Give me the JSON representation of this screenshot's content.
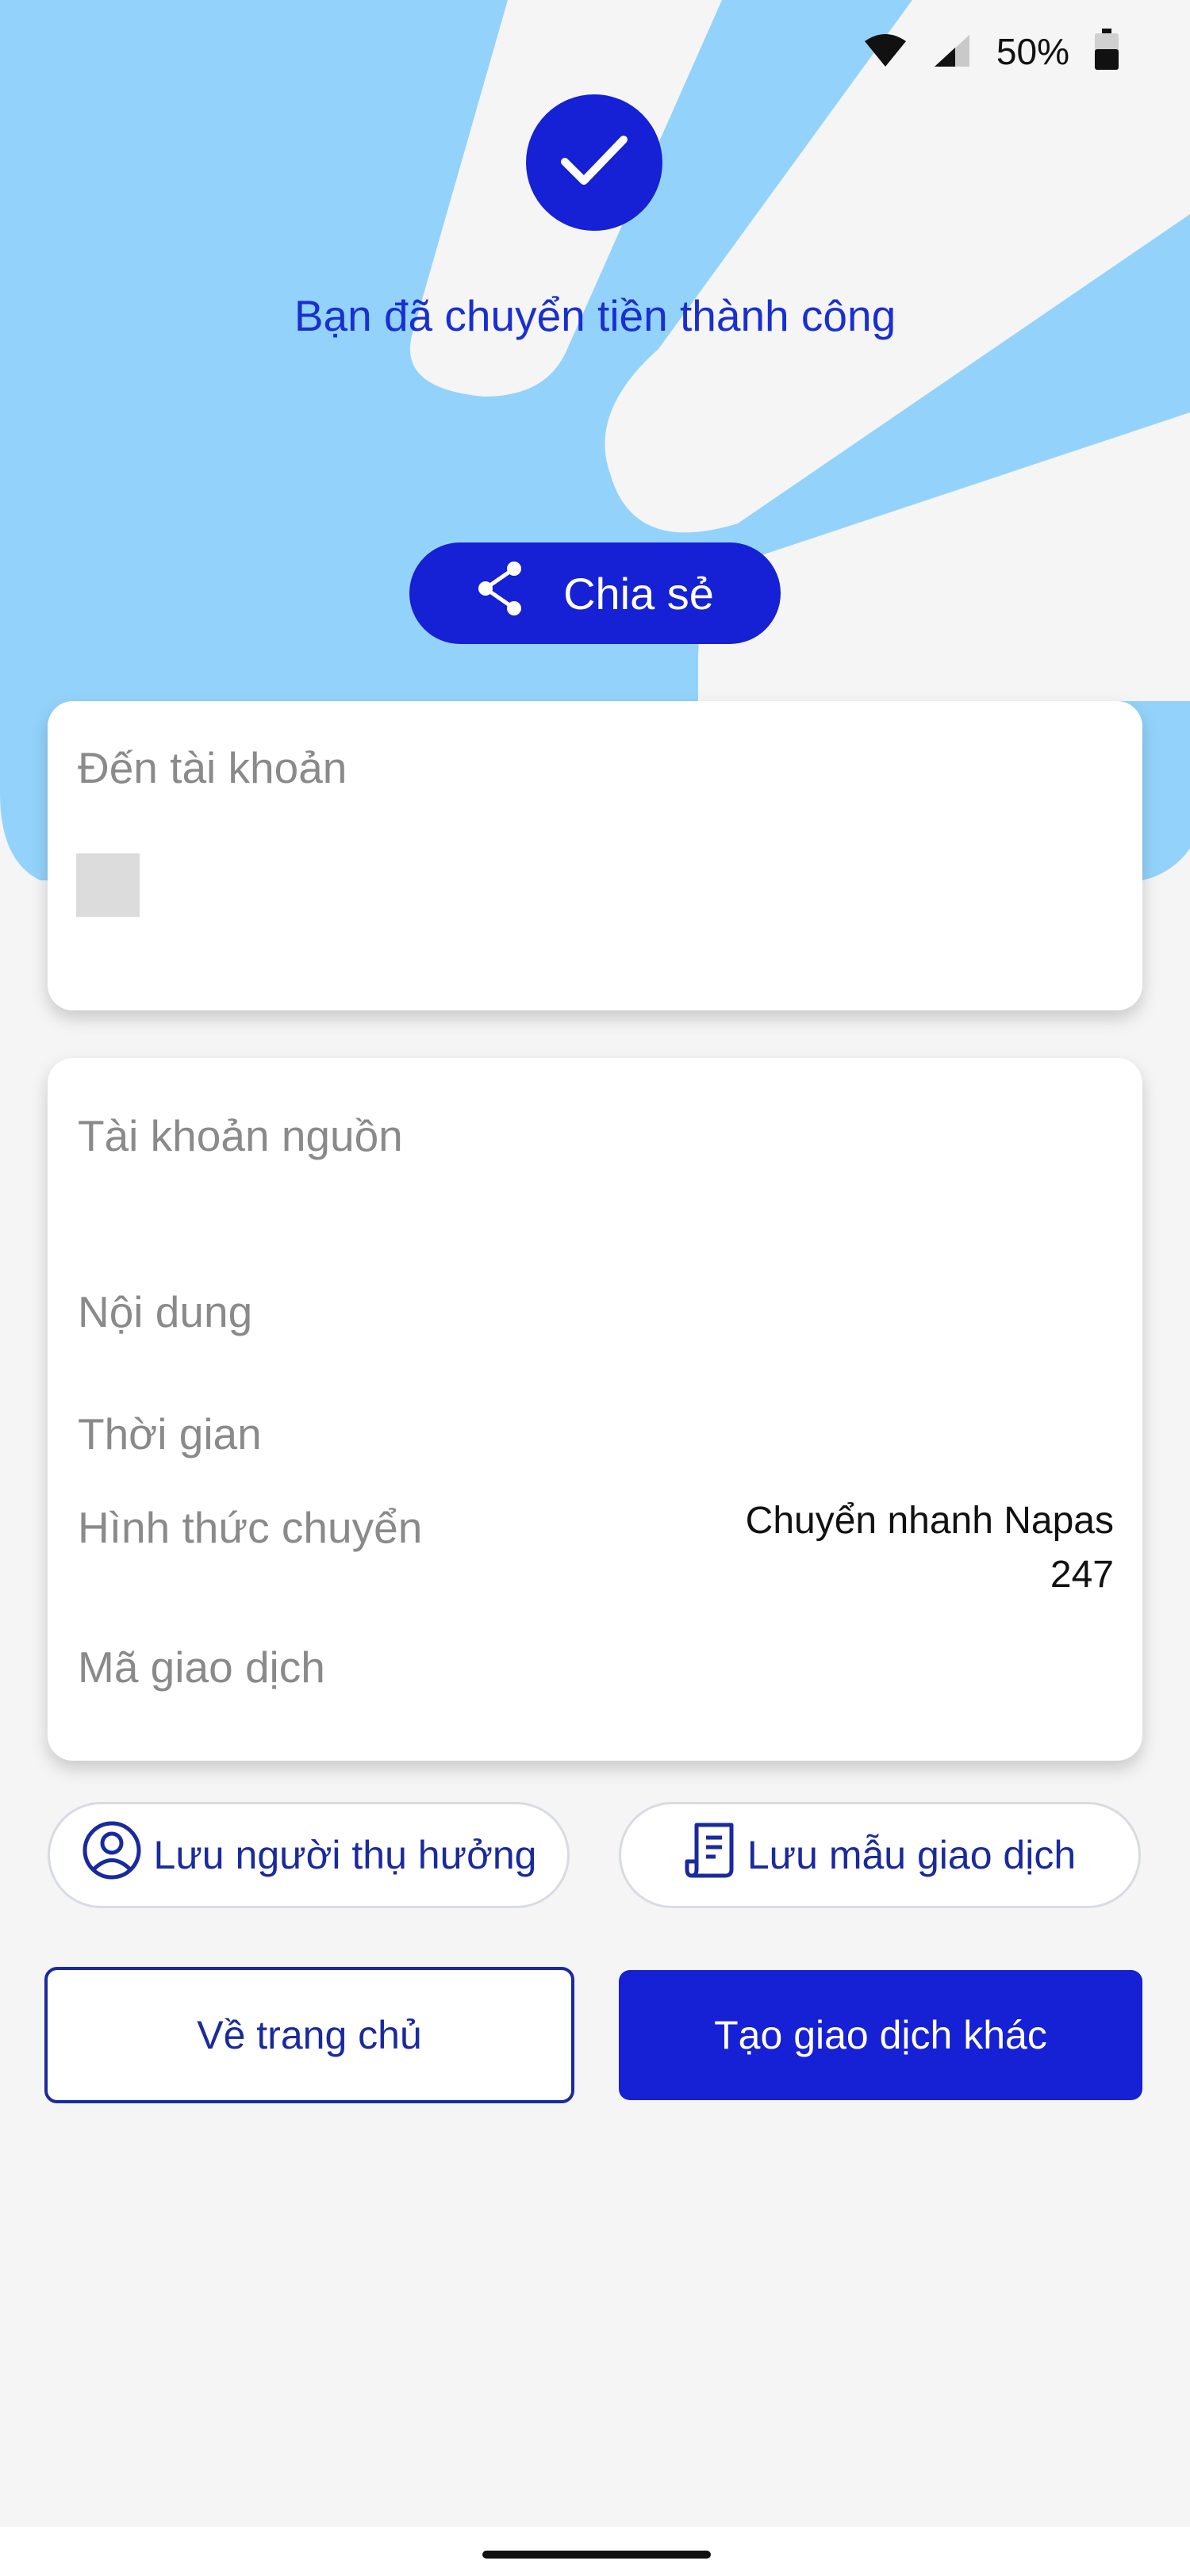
{
  "status_bar": {
    "battery_percent": "50%",
    "icons": [
      "wifi-icon",
      "signal-icon",
      "battery-icon"
    ]
  },
  "header": {
    "success_icon": "check-icon",
    "title": "Bạn đã chuyển tiền thành công"
  },
  "share_button": {
    "icon": "share-icon",
    "label": "Chia sẻ"
  },
  "recipient_card": {
    "label": "Đến tài khoản"
  },
  "details_card": {
    "rows": [
      {
        "label": "Tài khoản nguồn",
        "value": ""
      },
      {
        "label": "Nội dung",
        "value": ""
      },
      {
        "label": "Thời gian",
        "value": ""
      },
      {
        "label": "Hình thức chuyển",
        "value_line1": "Chuyển nhanh Napas",
        "value_line2": "247"
      },
      {
        "label": "Mã giao dịch",
        "value": ""
      }
    ]
  },
  "save_actions": {
    "save_beneficiary": {
      "icon": "user-circle-icon",
      "label": "Lưu người thụ hưởng"
    },
    "save_template": {
      "icon": "receipt-icon",
      "label": "Lưu mẫu giao dịch"
    }
  },
  "bottom_actions": {
    "home_label": "Về trang chủ",
    "new_transaction_label": "Tạo giao dịch khác"
  },
  "colors": {
    "primary": "#1620d4",
    "light_blue": "#93d3fb",
    "background": "#f5f5f6",
    "label_gray": "#8a8a8a",
    "outline_navy": "#1a2a9e"
  }
}
